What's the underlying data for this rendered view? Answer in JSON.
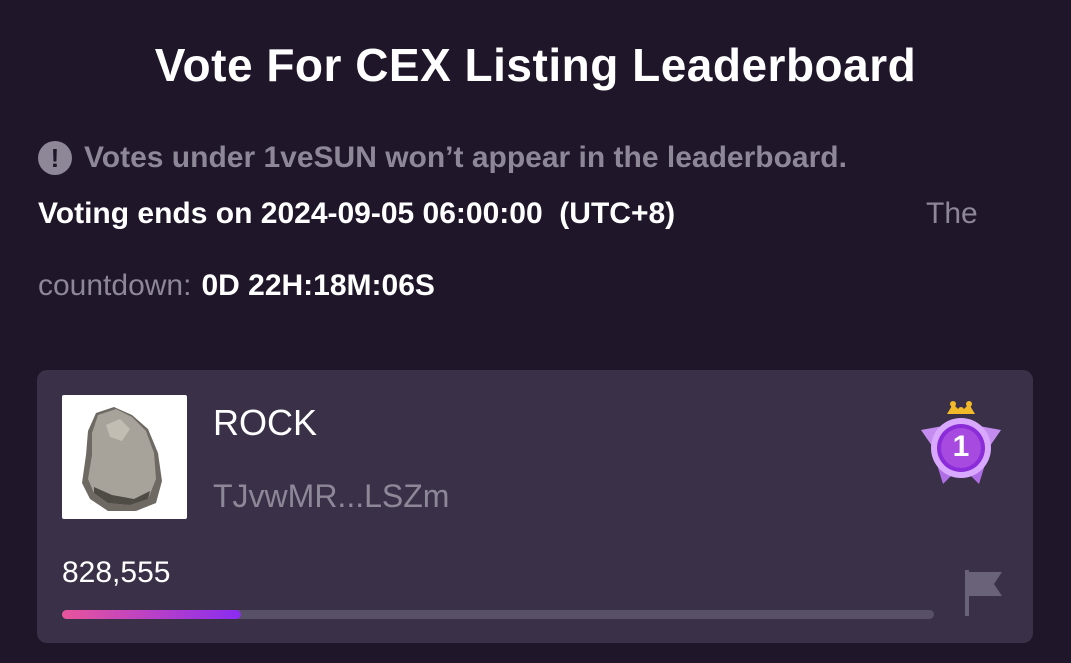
{
  "header": {
    "title": "Vote For CEX Listing Leaderboard"
  },
  "notice": {
    "icon": "exclamation-icon",
    "text": "Votes under 1veSUN won’t appear in the leaderboard."
  },
  "voting": {
    "ends_text": "Voting ends on 2024-09-05 06:00:00  (UTC+8)",
    "the_text": "The",
    "countdown_label": "countdown:",
    "countdown_value": "0D 22H:18M:06S"
  },
  "entry": {
    "rank": "1",
    "name": "ROCK",
    "address": "TJvwMR...LSZm",
    "votes": "828,555",
    "progress_fraction": 0.205,
    "rank_icon": "crown-medal-icon",
    "token_icon": "rock-icon",
    "action_icon": "flag-icon",
    "colors": {
      "bar_start": "#e8559c",
      "bar_end": "#8a2cf0",
      "medal": "#a64ae0"
    }
  }
}
